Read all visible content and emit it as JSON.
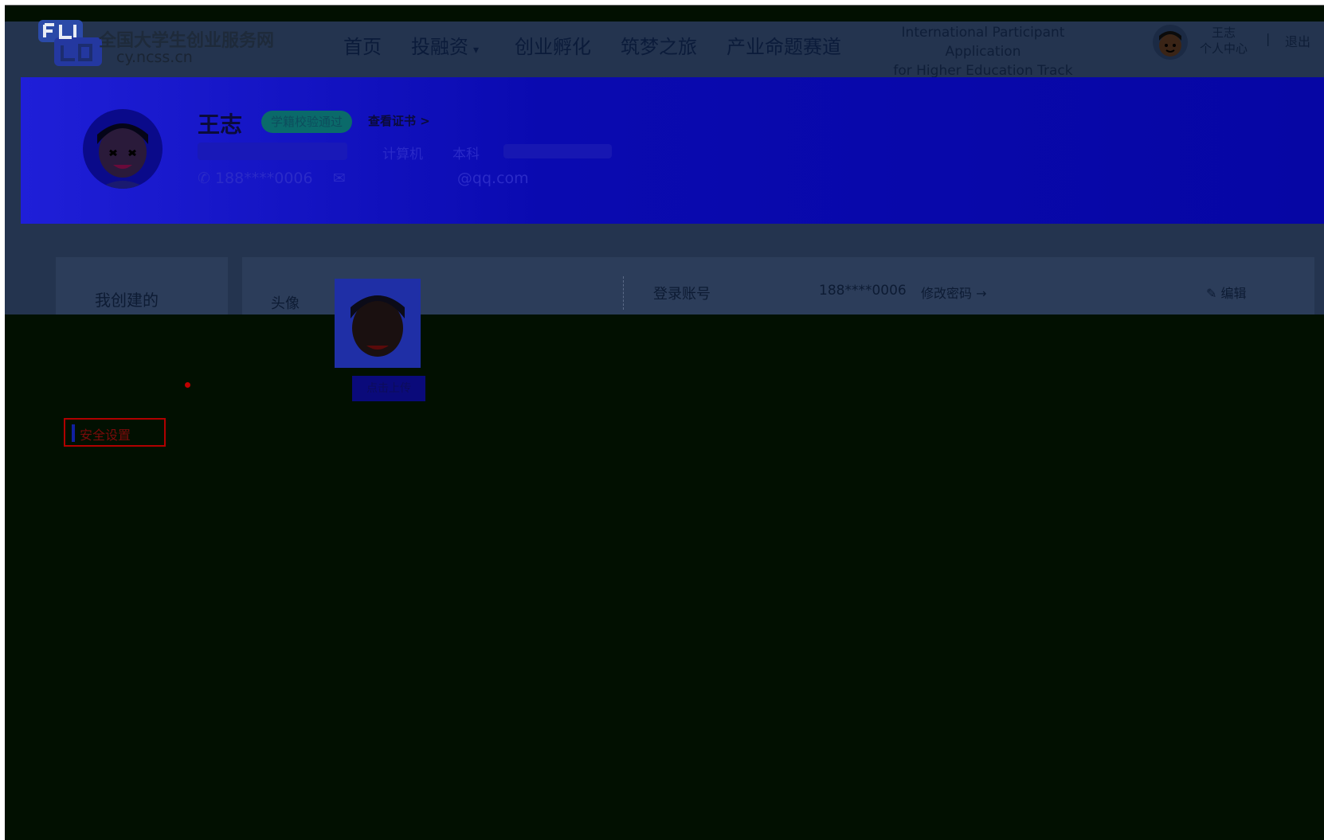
{
  "site": {
    "name": "全国大学生创业服务网",
    "url": "cy.ncss.cn"
  },
  "nav": {
    "home": "首页",
    "finance": "投融资",
    "incubate": "创业孵化",
    "journey": "筑梦之旅",
    "track": "产业命题赛道",
    "intl_line1": "International Participant Application",
    "intl_line2": "for Higher Education Track",
    "user_name": "王志",
    "user_center": "个人中心",
    "separator": "|",
    "logout": "退出"
  },
  "profile": {
    "name": "王志",
    "verify_badge": "学籍校验通过",
    "view_cert": "查看证书 >",
    "major": "计算机",
    "degree": "本科",
    "phone": "188****0006",
    "email_suffix": "@qq.com"
  },
  "sidebar": {
    "title": "我创建的",
    "highlighted_item": "安全设置"
  },
  "account": {
    "avatar_label": "头像",
    "upload_button": "点击上传",
    "login_label": "登录账号",
    "login_value": "188****0006",
    "change_password": "修改密码 →",
    "edit": "编辑"
  },
  "colors": {
    "nav_bg": "#24344f",
    "banner": "#0606a4",
    "overlay": "#021001",
    "highlight_border": "#b00000"
  }
}
